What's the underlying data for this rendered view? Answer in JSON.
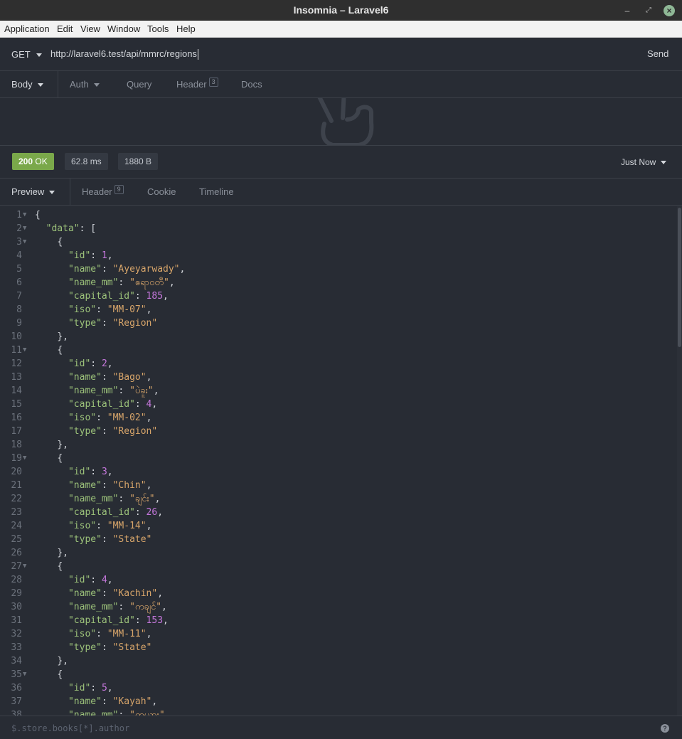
{
  "window": {
    "title": "Insomnia – Laravel6"
  },
  "menu": [
    "Application",
    "Edit",
    "View",
    "Window",
    "Tools",
    "Help"
  ],
  "request": {
    "method": "GET",
    "url": "http://laravel6.test/api/mmrc/regions",
    "send_label": "Send"
  },
  "request_tabs": {
    "body": "Body",
    "auth": "Auth",
    "query": "Query",
    "header": "Header",
    "header_count": "3",
    "docs": "Docs"
  },
  "response_status": {
    "code": "200",
    "text": "OK",
    "time": "62.8 ms",
    "size": "1880 B",
    "when": "Just Now"
  },
  "response_tabs": {
    "preview": "Preview",
    "header": "Header",
    "header_count": "9",
    "cookie": "Cookie",
    "timeline": "Timeline"
  },
  "code_lines": [
    {
      "n": "1",
      "fold": true,
      "text": "{"
    },
    {
      "n": "2",
      "fold": true,
      "text": "  \"data\": ["
    },
    {
      "n": "3",
      "fold": true,
      "text": "    {"
    },
    {
      "n": "4",
      "fold": false,
      "text": "      \"id\": 1,"
    },
    {
      "n": "5",
      "fold": false,
      "text": "      \"name\": \"Ayeyarwady\","
    },
    {
      "n": "6",
      "fold": false,
      "text": "      \"name_mm\": \"ဧရာဝတီ\","
    },
    {
      "n": "7",
      "fold": false,
      "text": "      \"capital_id\": 185,"
    },
    {
      "n": "8",
      "fold": false,
      "text": "      \"iso\": \"MM-07\","
    },
    {
      "n": "9",
      "fold": false,
      "text": "      \"type\": \"Region\""
    },
    {
      "n": "10",
      "fold": false,
      "text": "    },"
    },
    {
      "n": "11",
      "fold": true,
      "text": "    {"
    },
    {
      "n": "12",
      "fold": false,
      "text": "      \"id\": 2,"
    },
    {
      "n": "13",
      "fold": false,
      "text": "      \"name\": \"Bago\","
    },
    {
      "n": "14",
      "fold": false,
      "text": "      \"name_mm\": \"ပဲခူး\","
    },
    {
      "n": "15",
      "fold": false,
      "text": "      \"capital_id\": 4,"
    },
    {
      "n": "16",
      "fold": false,
      "text": "      \"iso\": \"MM-02\","
    },
    {
      "n": "17",
      "fold": false,
      "text": "      \"type\": \"Region\""
    },
    {
      "n": "18",
      "fold": false,
      "text": "    },"
    },
    {
      "n": "19",
      "fold": true,
      "text": "    {"
    },
    {
      "n": "20",
      "fold": false,
      "text": "      \"id\": 3,"
    },
    {
      "n": "21",
      "fold": false,
      "text": "      \"name\": \"Chin\","
    },
    {
      "n": "22",
      "fold": false,
      "text": "      \"name_mm\": \"ချင်း\","
    },
    {
      "n": "23",
      "fold": false,
      "text": "      \"capital_id\": 26,"
    },
    {
      "n": "24",
      "fold": false,
      "text": "      \"iso\": \"MM-14\","
    },
    {
      "n": "25",
      "fold": false,
      "text": "      \"type\": \"State\""
    },
    {
      "n": "26",
      "fold": false,
      "text": "    },"
    },
    {
      "n": "27",
      "fold": true,
      "text": "    {"
    },
    {
      "n": "28",
      "fold": false,
      "text": "      \"id\": 4,"
    },
    {
      "n": "29",
      "fold": false,
      "text": "      \"name\": \"Kachin\","
    },
    {
      "n": "30",
      "fold": false,
      "text": "      \"name_mm\": \"ကချင်\","
    },
    {
      "n": "31",
      "fold": false,
      "text": "      \"capital_id\": 153,"
    },
    {
      "n": "32",
      "fold": false,
      "text": "      \"iso\": \"MM-11\","
    },
    {
      "n": "33",
      "fold": false,
      "text": "      \"type\": \"State\""
    },
    {
      "n": "34",
      "fold": false,
      "text": "    },"
    },
    {
      "n": "35",
      "fold": true,
      "text": "    {"
    },
    {
      "n": "36",
      "fold": false,
      "text": "      \"id\": 5,"
    },
    {
      "n": "37",
      "fold": false,
      "text": "      \"name\": \"Kayah\","
    },
    {
      "n": "38",
      "fold": false,
      "text": "      \"name_mm\": \"ကယား\","
    }
  ],
  "filter": {
    "placeholder": "$.store.books[*].author"
  },
  "colors": {
    "status_ok": "#7aa84a",
    "json_key": "#9cc27a",
    "json_string": "#d7a56a",
    "json_number": "#c678dd"
  },
  "icons": {
    "watermark": "insomnia-peace-hand-icon",
    "help": "question-circle-icon"
  }
}
